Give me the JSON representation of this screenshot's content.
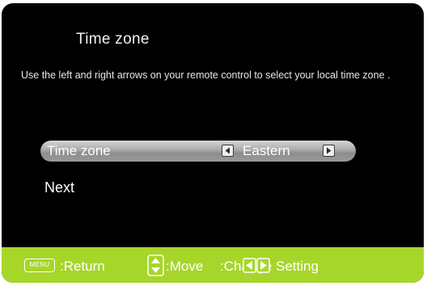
{
  "screen": {
    "title": "Time  zone",
    "instructions": "Use the left and right arrows on your remote control to select your local time zone ."
  },
  "selector": {
    "label": "Time  zone",
    "value": "Eastern"
  },
  "next_label": "Next",
  "footer": {
    "menu_key": "MENU",
    "return_text": ":Return",
    "move_text": ":Move",
    "change_text": ":Change Setting"
  },
  "colors": {
    "background": "#000000",
    "footer": "#a6d62a",
    "highlight": "#a9a9a9"
  },
  "icons": {
    "left_arrow": "left-arrow-icon",
    "right_arrow": "right-arrow-icon",
    "up_down": "up-down-arrows-icon",
    "left_right": "left-right-arrows-icon"
  }
}
